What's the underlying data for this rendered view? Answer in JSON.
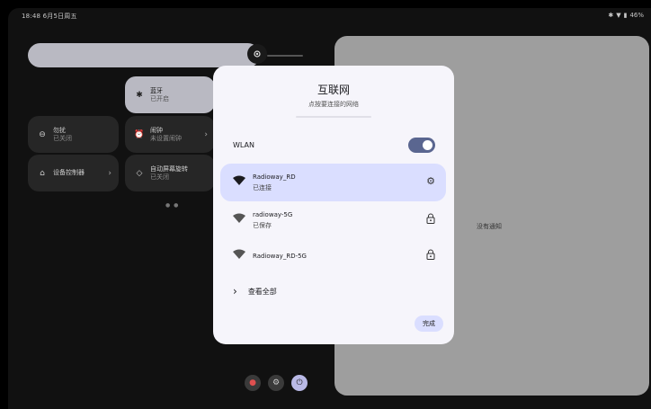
{
  "status_bar": {
    "time_date": "18:48  6月5日周五",
    "battery": "46%"
  },
  "quick_settings": {
    "tiles": [
      {
        "title": "蓝牙",
        "subtitle": "已开启"
      },
      {
        "title": "勿扰",
        "subtitle": "已关闭"
      },
      {
        "title": "闹钟",
        "subtitle": "未设置闹钟"
      },
      {
        "title": "设备控制器",
        "subtitle": ""
      },
      {
        "title": "自动屏幕旋转",
        "subtitle": "已关闭"
      }
    ],
    "page_indicator": "● ●"
  },
  "notifications": {
    "empty_text": "没有通知"
  },
  "wifi_dialog": {
    "title": "互联网",
    "subtitle": "点按要连接的网络",
    "wlan_label": "WLAN",
    "wlan_enabled": true,
    "networks": [
      {
        "name": "Radioway_RD",
        "status": "已连接"
      },
      {
        "name": "radioway-5G",
        "status": "已保存"
      },
      {
        "name": "Radioway_RD-5G",
        "status": ""
      }
    ],
    "see_all": "查看全部",
    "done": "完成"
  },
  "colors": {
    "accent": "#5a6690",
    "connected_bg": "#dadeff",
    "panel_bg": "#9e9e9e"
  }
}
